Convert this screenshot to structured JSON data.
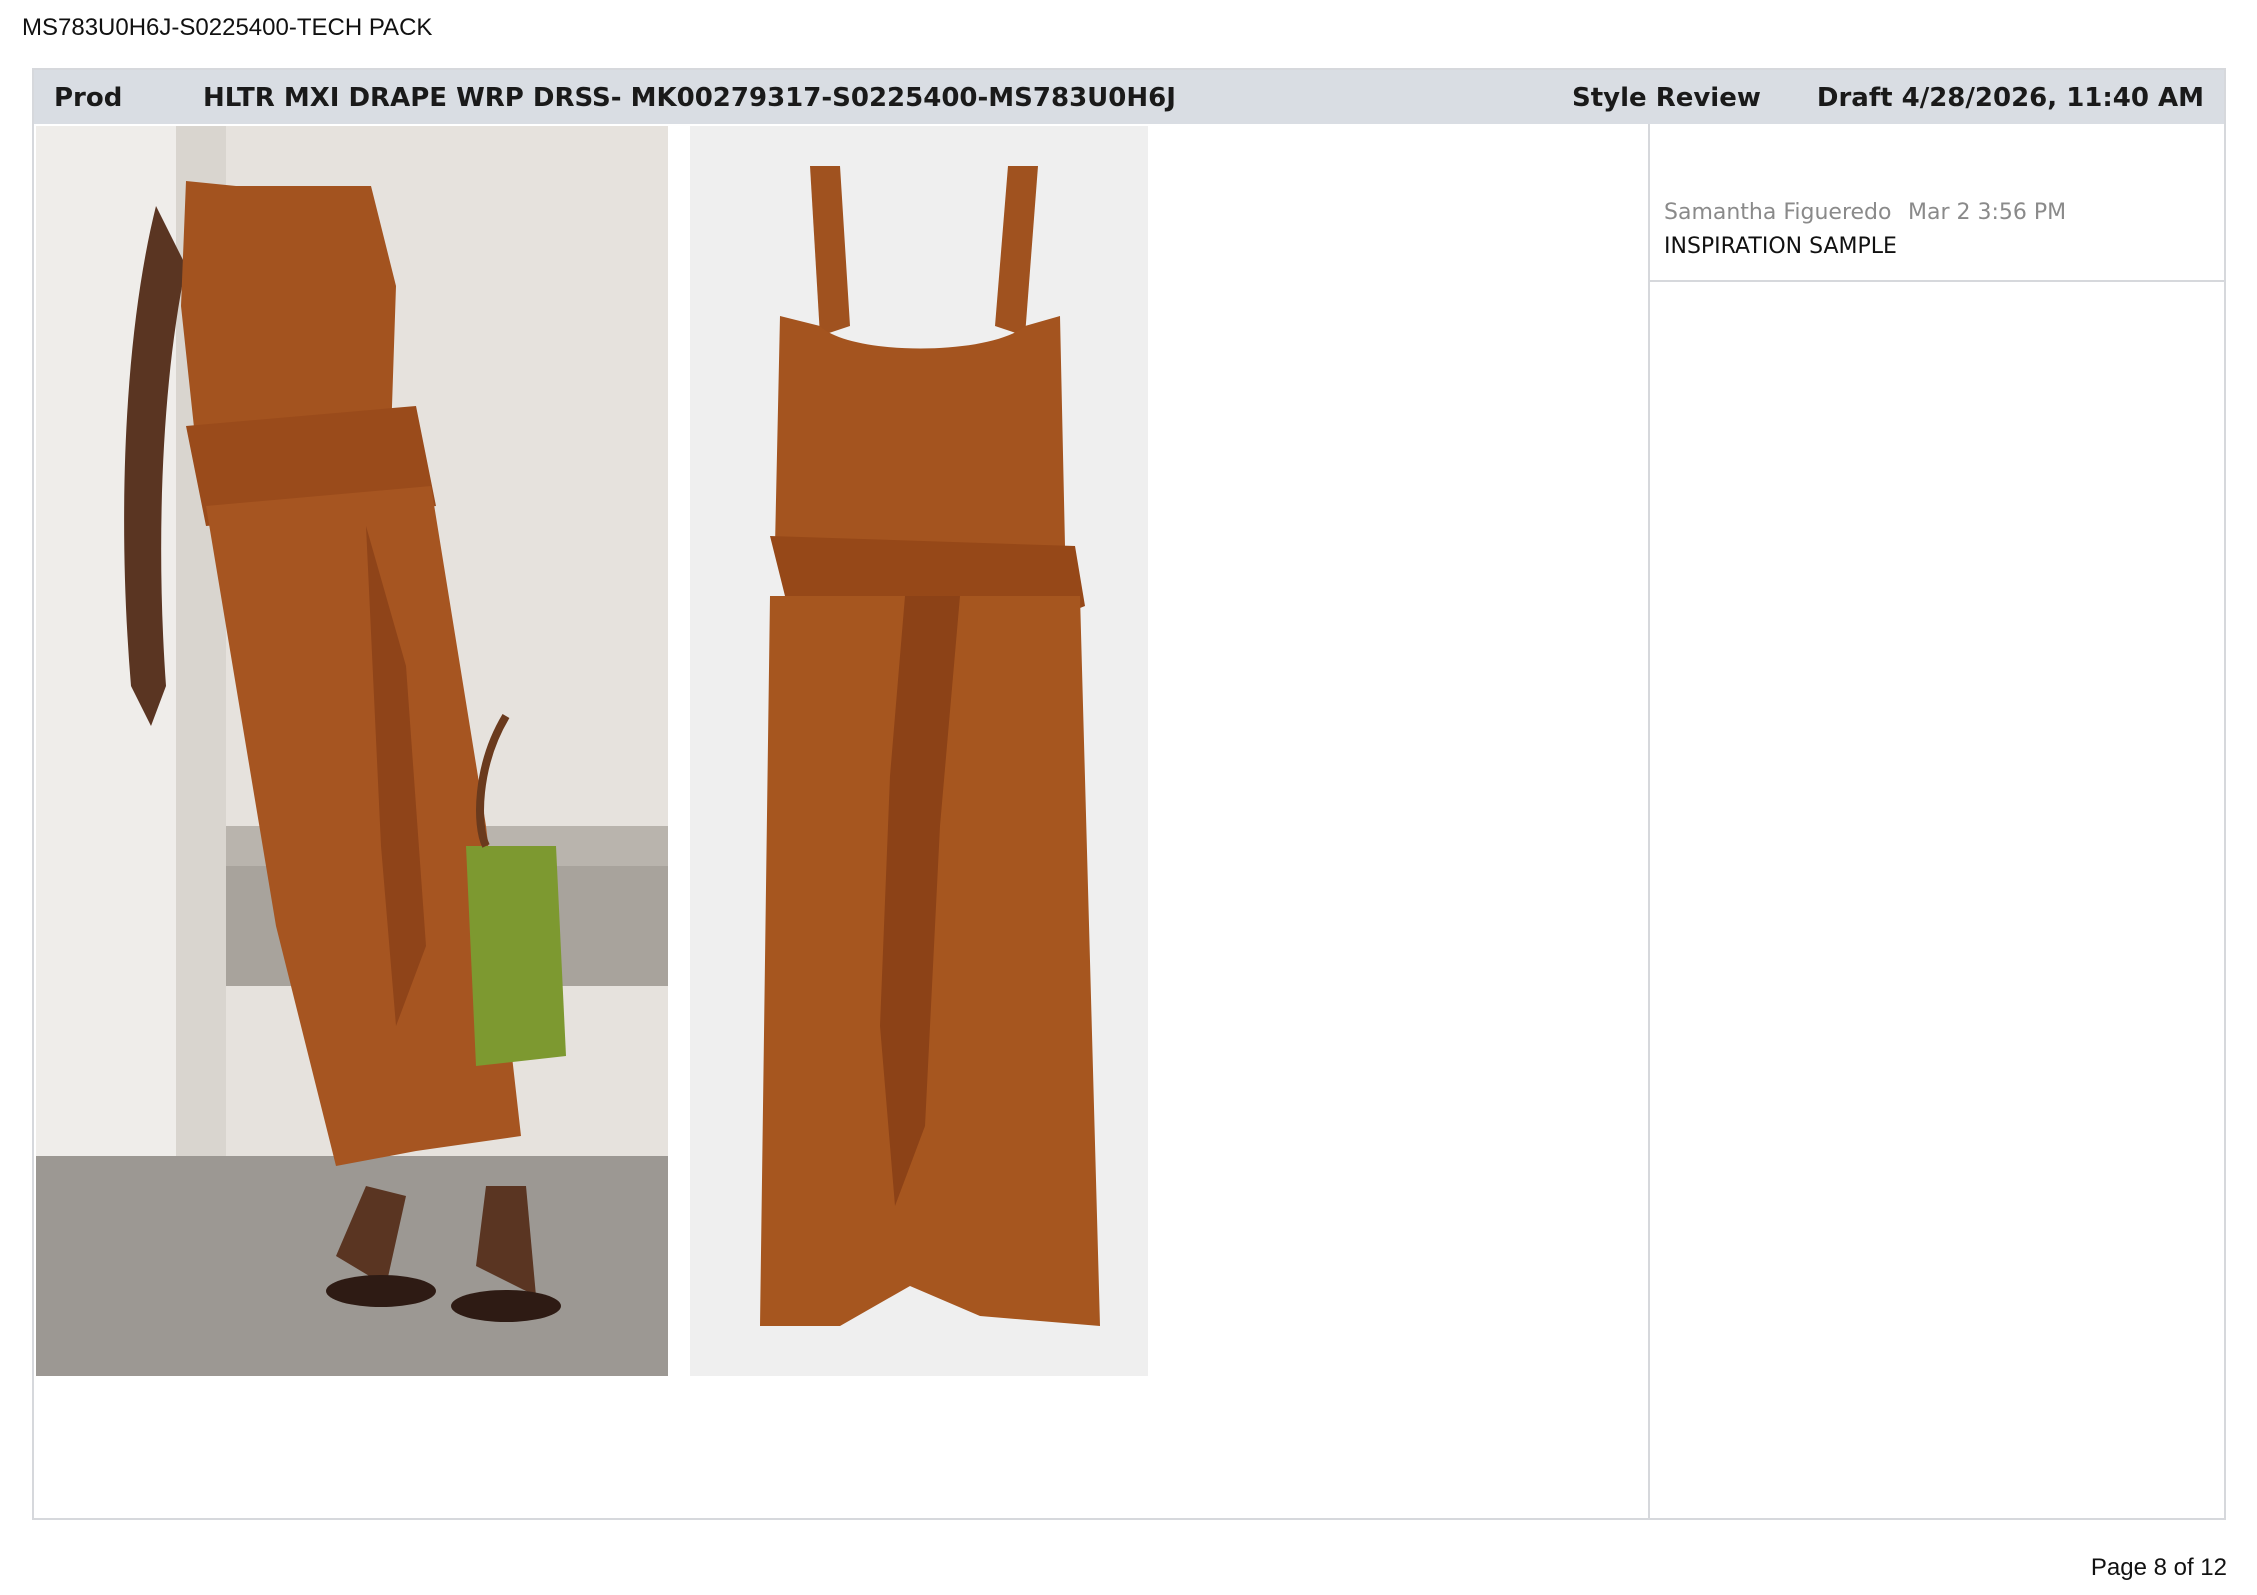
{
  "document": {
    "id_line": "MS783U0H6J-S0225400-TECH PACK",
    "page_label": "Page 8 of 12"
  },
  "header": {
    "stage": "Prod",
    "style_title": "HLTR MXI DRAPE WRP DRSS- MK00279317-S0225400-MS783U0H6J",
    "section": "Style Review",
    "status": "Draft 4/28/2026, 11:40 AM"
  },
  "comment": {
    "author": "Samantha Figueredo",
    "time": "Mar 2 3:56 PM",
    "text": "INSPIRATION SAMPLE"
  },
  "colors": {
    "header_bg": "#d9dde3",
    "garment_rust": "#a0521f",
    "border": "#d6d8dc"
  }
}
